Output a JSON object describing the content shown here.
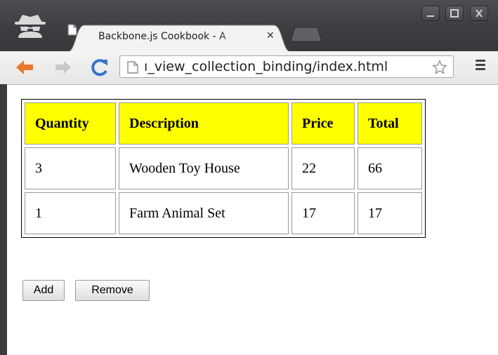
{
  "browser": {
    "tab_title": "Backbone.js Cookbook - A",
    "address": "ı_view_collection_binding/index.html",
    "icons": {
      "incognito": "incognito-icon",
      "page": "page-icon",
      "close": "close-icon",
      "back": "back-arrow-icon",
      "forward": "forward-arrow-icon",
      "reload": "reload-icon",
      "star": "star-icon",
      "menu": "menu-icon"
    }
  },
  "table": {
    "headers": [
      "Quantity",
      "Description",
      "Price",
      "Total"
    ],
    "rows": [
      [
        "3",
        "Wooden Toy House",
        "22",
        "66"
      ],
      [
        "1",
        "Farm Animal Set",
        "17",
        "17"
      ]
    ],
    "header_color": "#ffff00"
  },
  "buttons": {
    "add": "Add",
    "remove": "Remove"
  },
  "colors": {
    "back_arrow": "#e8782a",
    "reload": "#3b73c9",
    "chrome_dark": "#3c3e42"
  }
}
